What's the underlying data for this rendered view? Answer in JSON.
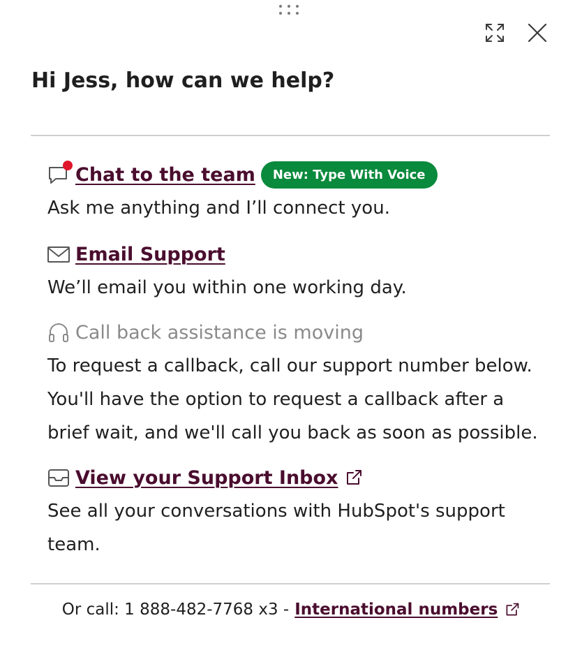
{
  "header": {
    "title": "Hi Jess, how can we help?"
  },
  "icons": {
    "drag": "drag-handle-icon",
    "expand": "expand-icon",
    "close": "close-icon"
  },
  "options": {
    "chat": {
      "title": "Chat to the team",
      "badge": "New: Type With Voice",
      "description": "Ask me anything and I’ll connect you.",
      "icon": "chat-bubble-icon",
      "has_notification": true
    },
    "email": {
      "title": "Email Support",
      "description": "We’ll email you within one working day.",
      "icon": "envelope-icon"
    },
    "callback": {
      "title": "Call back assistance is moving",
      "description": "To request a callback, call our support number below. You'll have the option to request a callback after a brief wait, and we'll call you back as soon as possible.",
      "icon": "headset-icon"
    },
    "inbox": {
      "title": "View your Support Inbox",
      "description": "See all your conversations with HubSpot's support team.",
      "icon": "inbox-tray-icon"
    }
  },
  "footer": {
    "call_text": "Or call: 1 888-482-7768 x3 -",
    "intl_link": "International numbers"
  },
  "colors": {
    "link": "#4a0d2e",
    "badge_bg": "#0a8a3c",
    "notification_dot": "#e0162b",
    "muted_text": "#8a8a8a",
    "divider": "#cfcfcf"
  }
}
